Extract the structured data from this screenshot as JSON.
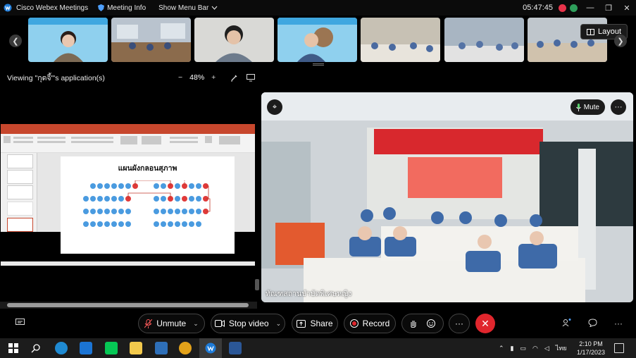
{
  "titlebar": {
    "app_name": "Cisco Webex Meetings",
    "meeting_info": "Meeting Info",
    "show_menu_bar": "Show Menu Bar",
    "clock": "05:47:45",
    "status_colors": [
      "#e8334a",
      "#2e9e5b"
    ]
  },
  "filmstrip": {
    "layout_label": "Layout",
    "thumbnails": [
      {
        "type": "person-banner",
        "bg": "#8fd0ee"
      },
      {
        "type": "classroom",
        "bg": "#b9c3ce"
      },
      {
        "type": "person",
        "bg": "#d9d9d6"
      },
      {
        "type": "person-banner",
        "bg": "#8fd0ee"
      },
      {
        "type": "classroom",
        "bg": "#c7c1b4"
      },
      {
        "type": "classroom",
        "bg": "#a8b5c2"
      },
      {
        "type": "classroom",
        "bg": "#bfc6cc"
      }
    ]
  },
  "share": {
    "viewing_label": "Viewing \"กุดจี้\"'s application(s)",
    "zoom_minus": "−",
    "zoom_value": "48%",
    "zoom_plus": "+",
    "slide_title": "แผนผังกลอนสุภาพ"
  },
  "video": {
    "name_label": "ทัณฑสถานบำบัดพิเศษหญิง",
    "mute_label": "Mute"
  },
  "controls": {
    "unmute": "Unmute",
    "stop_video": "Stop video",
    "share": "Share",
    "record": "Record",
    "more": "···"
  },
  "taskbar": {
    "time": "2:10 PM",
    "date": "1/17/2023",
    "language": "ไทย"
  }
}
